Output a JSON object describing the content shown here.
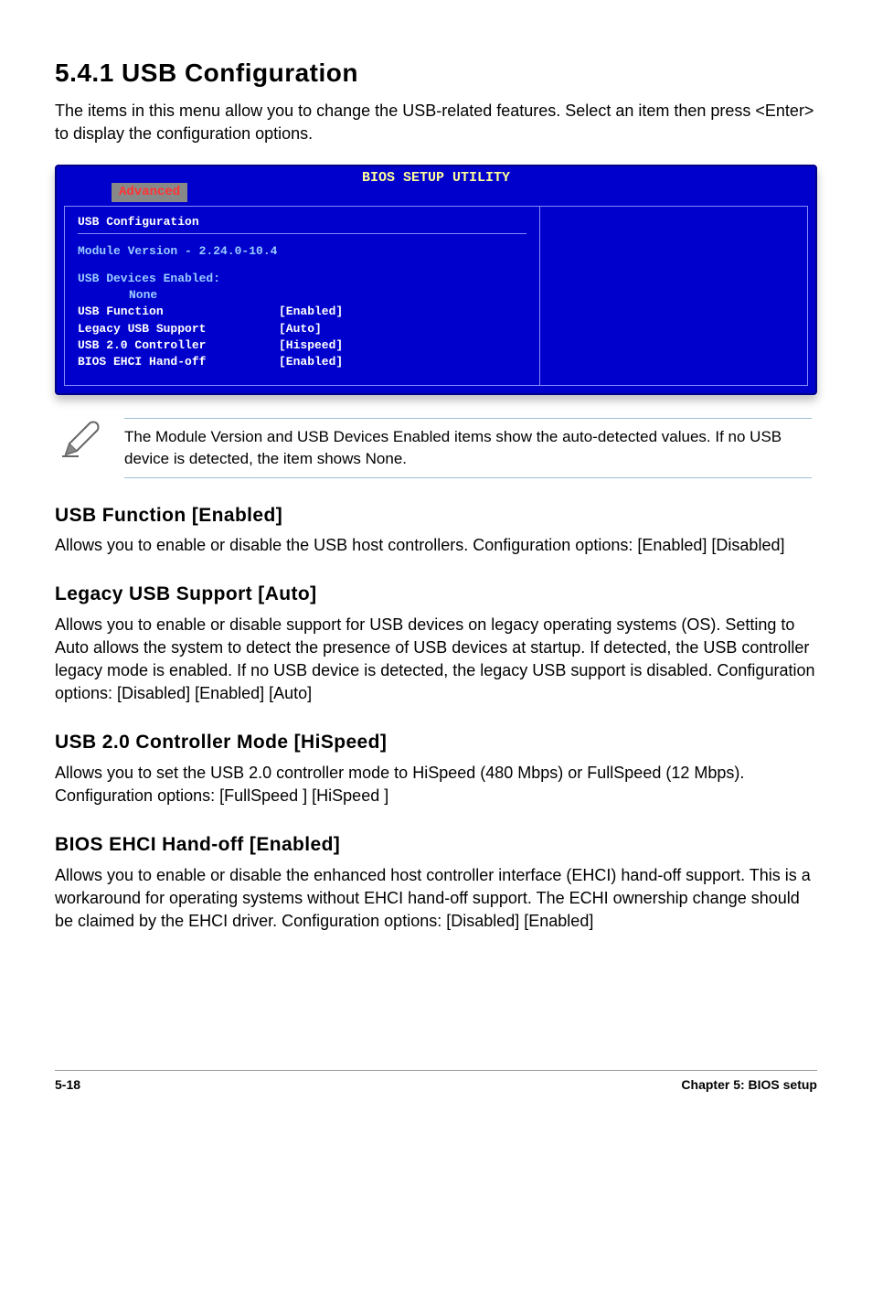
{
  "heading": "5.4.1   USB Configuration",
  "intro": "The items in this menu allow you to change the USB-related features. Select an item then press <Enter> to display the configuration options.",
  "bios": {
    "title": "BIOS SETUP UTILITY",
    "tab": "Advanced",
    "panel_title": "USB Configuration",
    "module_version": "Module Version - 2.24.0-10.4",
    "devices_label": "USB Devices Enabled:",
    "devices_value": "None",
    "options": [
      {
        "label": "USB Function",
        "value": "[Enabled]"
      },
      {
        "label": "Legacy USB Support",
        "value": "[Auto]"
      },
      {
        "label": "USB 2.0 Controller",
        "value": "[Hispeed]"
      },
      {
        "label": "BIOS EHCI Hand-off",
        "value": "[Enabled]"
      }
    ]
  },
  "note": "The Module Version and USB Devices Enabled items show the auto-detected values. If no USB device is detected, the item shows None.",
  "sections": [
    {
      "title": "USB Function [Enabled]",
      "body": "Allows you to enable or disable the USB host controllers. Configuration options: [Enabled] [Disabled]"
    },
    {
      "title": "Legacy USB Support [Auto]",
      "body": "Allows you to enable or disable support for USB devices on legacy operating systems (OS). Setting to Auto allows the system to detect the presence of USB devices at startup. If detected, the USB controller legacy mode is enabled. If no USB device is detected, the legacy USB support is disabled. Configuration options: [Disabled] [Enabled] [Auto]"
    },
    {
      "title": "USB 2.0 Controller Mode [HiSpeed]",
      "body": "Allows you to set the USB 2.0 controller mode to HiSpeed (480 Mbps) or FullSpeed (12 Mbps). Configuration options: [FullSpeed ] [HiSpeed ]"
    },
    {
      "title": "BIOS EHCI Hand-off [Enabled]",
      "body": "Allows you to enable or disable the enhanced host controller interface (EHCI) hand-off support. This is a workaround for operating systems without EHCI hand-off support. The ECHI ownership change should be claimed by the EHCI driver. Configuration options: [Disabled] [Enabled]"
    }
  ],
  "footer_left": "5-18",
  "footer_right": "Chapter 5: BIOS setup"
}
